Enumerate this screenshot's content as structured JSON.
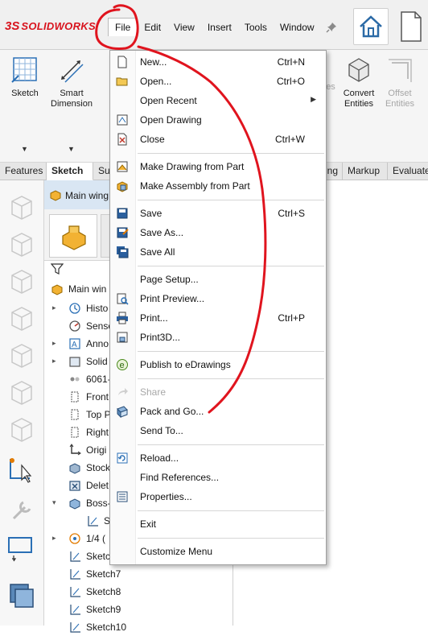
{
  "app": {
    "logo_ds": "3S",
    "logo_text": "SOLIDWORKS"
  },
  "menubar": {
    "items": [
      "File",
      "Edit",
      "View",
      "Insert",
      "Tools",
      "Window"
    ]
  },
  "ribbon": {
    "sketch": "Sketch",
    "smart_dimension": "Smart Dimension",
    "convert_entities": "Convert Entities",
    "offset_entities": "Offset Entities",
    "partial_es": "es"
  },
  "tabs": {
    "features": "Features",
    "sketch": "Sketch",
    "su": "Su",
    "ing": "ing",
    "markup": "Markup",
    "evaluate": "Evaluate"
  },
  "feature_manager": {
    "header": "Main wing",
    "root": "Main win",
    "rows": [
      {
        "label": "Histo",
        "expand": true,
        "icon": "history-icon"
      },
      {
        "label": "Senso",
        "expand": false,
        "icon": "sensor-icon"
      },
      {
        "label": "Anno",
        "expand": true,
        "icon": "annotations-icon"
      },
      {
        "label": "Solid",
        "expand": true,
        "icon": "solid-bodies-icon"
      },
      {
        "label": "6061-",
        "expand": false,
        "icon": "material-icon"
      },
      {
        "label": "Front",
        "expand": false,
        "icon": "plane-icon"
      },
      {
        "label": "Top P",
        "expand": false,
        "icon": "plane-icon"
      },
      {
        "label": "Right",
        "expand": false,
        "icon": "plane-icon"
      },
      {
        "label": "Origi",
        "expand": false,
        "icon": "origin-icon"
      },
      {
        "label": "Stock",
        "expand": false,
        "icon": "stock-icon"
      },
      {
        "label": "Delet",
        "expand": false,
        "icon": "delete-body-icon"
      },
      {
        "label": "Boss-",
        "expand": true,
        "icon": "boss-extrude-icon"
      },
      {
        "label": "S",
        "expand": false,
        "icon": "sketch-icon",
        "indent": true
      },
      {
        "label": "1/4 (",
        "expand": true,
        "icon": "pattern-icon"
      },
      {
        "label": "Sketc",
        "expand": false,
        "icon": "sketch-icon"
      },
      {
        "label": "Sketch7",
        "expand": false,
        "icon": "sketch-icon"
      },
      {
        "label": "Sketch8",
        "expand": false,
        "icon": "sketch-icon"
      },
      {
        "label": "Sketch9",
        "expand": false,
        "icon": "sketch-icon"
      },
      {
        "label": "Sketch10",
        "expand": false,
        "icon": "sketch-icon"
      }
    ]
  },
  "file_menu": {
    "items": [
      {
        "label": "New...",
        "shortcut": "Ctrl+N",
        "icon": "new-document-icon"
      },
      {
        "label": "Open...",
        "shortcut": "Ctrl+O",
        "icon": "open-folder-icon"
      },
      {
        "label": "Open Recent",
        "shortcut": "",
        "icon": "",
        "submenu": true
      },
      {
        "label": "Open Drawing",
        "shortcut": "",
        "icon": "open-drawing-icon"
      },
      {
        "label": "Close",
        "shortcut": "Ctrl+W",
        "icon": "close-document-icon"
      },
      {
        "label": "Make Drawing from Part",
        "shortcut": "",
        "icon": "make-drawing-icon"
      },
      {
        "label": "Make Assembly from Part",
        "shortcut": "",
        "icon": "make-assembly-icon"
      },
      {
        "label": "Save",
        "shortcut": "Ctrl+S",
        "icon": "save-icon"
      },
      {
        "label": "Save As...",
        "shortcut": "",
        "icon": "save-as-icon"
      },
      {
        "label": "Save All",
        "shortcut": "",
        "icon": "save-all-icon"
      },
      {
        "label": "Page Setup...",
        "shortcut": "",
        "icon": ""
      },
      {
        "label": "Print Preview...",
        "shortcut": "",
        "icon": "print-preview-icon"
      },
      {
        "label": "Print...",
        "shortcut": "Ctrl+P",
        "icon": "print-icon"
      },
      {
        "label": "Print3D...",
        "shortcut": "",
        "icon": "print3d-icon"
      },
      {
        "label": "Publish to eDrawings",
        "shortcut": "",
        "icon": "edrawings-icon"
      },
      {
        "label": "Share",
        "shortcut": "",
        "icon": "share-icon",
        "disabled": true
      },
      {
        "label": "Pack and Go...",
        "shortcut": "",
        "icon": "pack-and-go-icon"
      },
      {
        "label": "Send To...",
        "shortcut": "",
        "icon": ""
      },
      {
        "label": "Reload...",
        "shortcut": "",
        "icon": "reload-icon"
      },
      {
        "label": "Find References...",
        "shortcut": "",
        "icon": ""
      },
      {
        "label": "Properties...",
        "shortcut": "",
        "icon": "properties-icon"
      },
      {
        "label": "Exit",
        "shortcut": "",
        "icon": ""
      },
      {
        "label": "Customize Menu",
        "shortcut": "",
        "icon": ""
      }
    ]
  },
  "annotation": {
    "color": "#e0141e"
  }
}
